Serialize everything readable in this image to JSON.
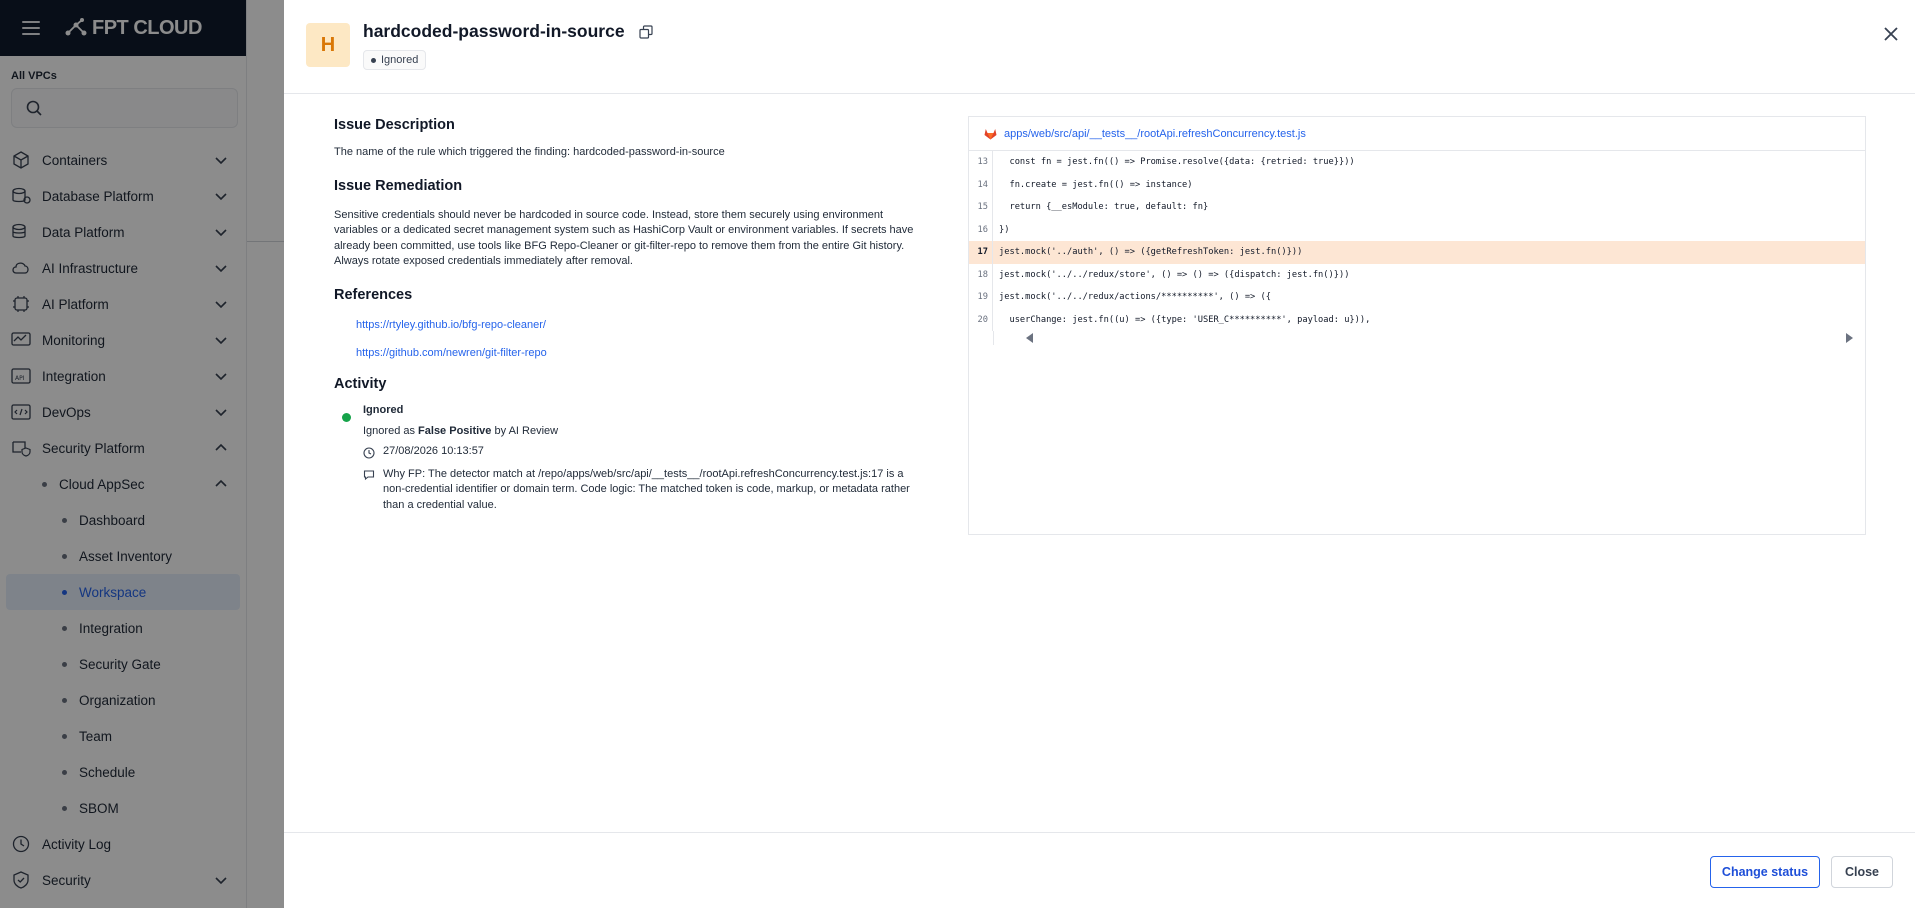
{
  "app": {
    "brand": "FPT CLOUD"
  },
  "sidebar": {
    "vpc_label": "All VPCs",
    "items": [
      {
        "label": "Containers",
        "icon": "containers-icon",
        "chevron": "down"
      },
      {
        "label": "Database Platform",
        "icon": "database-icon",
        "chevron": "down"
      },
      {
        "label": "Data Platform",
        "icon": "data-platform-icon",
        "chevron": "down"
      },
      {
        "label": "AI Infrastructure",
        "icon": "ai-infrastructure-icon",
        "chevron": "down"
      },
      {
        "label": "AI Platform",
        "icon": "ai-platform-icon",
        "chevron": "down"
      },
      {
        "label": "Monitoring",
        "icon": "monitoring-icon",
        "chevron": "down"
      },
      {
        "label": "Integration",
        "icon": "api-icon",
        "chevron": "down"
      },
      {
        "label": "DevOps",
        "icon": "devops-icon",
        "chevron": "down"
      },
      {
        "label": "Security Platform",
        "icon": "security-platform-icon",
        "chevron": "up"
      },
      {
        "label": "Cloud AppSec",
        "chevron": "up"
      },
      {
        "label": "Dashboard"
      },
      {
        "label": "Asset Inventory"
      },
      {
        "label": "Workspace",
        "active": true
      },
      {
        "label": "Integration"
      },
      {
        "label": "Security Gate"
      },
      {
        "label": "Organization"
      },
      {
        "label": "Team"
      },
      {
        "label": "Schedule"
      },
      {
        "label": "SBOM"
      },
      {
        "label": "Activity Log",
        "icon": "clock-icon"
      },
      {
        "label": "Security",
        "icon": "shield-icon",
        "chevron": "down"
      }
    ]
  },
  "finding": {
    "severity_letter": "H",
    "severity_color": "#d97706",
    "title": "hardcoded-password-in-source",
    "status": "Ignored"
  },
  "issue": {
    "description_title": "Issue Description",
    "description": "The name of the rule which triggered the finding: hardcoded-password-in-source",
    "remediation_title": "Issue Remediation",
    "remediation": "Sensitive credentials should never be hardcoded in source code. Instead, store them securely using environment variables or a dedicated secret management system such as HashiCorp Vault or environment variables. If secrets have already been committed, use tools like BFG Repo-Cleaner or git-filter-repo to remove them from the entire Git history. Always rotate exposed credentials immediately after removal.",
    "references_title": "References",
    "references": [
      "https://rtyley.github.io/bfg-repo-cleaner/",
      "https://github.com/newren/git-filter-repo"
    ]
  },
  "activity": {
    "title": "Activity",
    "status": "Ignored",
    "ignored_as_prefix": "Ignored as",
    "ignored_as_value": "False Positive",
    "by_prefix": "by",
    "by_value": "AI Review",
    "timestamp": "27/08/2026 10:13:57",
    "comment": "Why FP: The detector match at /repo/apps/web/src/api/__tests__/rootApi.refreshConcurrency.test.js:17 is a non-credential identifier or domain term. Code logic: The matched token is code, markup, or metadata rather than a credential value."
  },
  "code": {
    "file_path": "apps/web/src/api/__tests__/rootApi.refreshConcurrency.test.js",
    "highlight_line": 17,
    "lines": [
      {
        "num": "13",
        "text": "  const fn = jest.fn(() => Promise.resolve({data: {retried: true}}))"
      },
      {
        "num": "14",
        "text": "  fn.create = jest.fn(() => instance)"
      },
      {
        "num": "15",
        "text": "  return {__esModule: true, default: fn}"
      },
      {
        "num": "16",
        "text": "})"
      },
      {
        "num": "17",
        "text": "jest.mock('../auth', () => ({getRefreshToken: jest.fn()}))"
      },
      {
        "num": "18",
        "text": "jest.mock('../../redux/store', () => () => ({dispatch: jest.fn()}))"
      },
      {
        "num": "19",
        "text": "jest.mock('../../redux/actions/**********', () => ({"
      },
      {
        "num": "20",
        "text": "  userChange: jest.fn((u) => ({type: 'USER_C**********', payload: u})),"
      }
    ]
  },
  "footer": {
    "change_status_label": "Change status",
    "close_label": "Close"
  }
}
